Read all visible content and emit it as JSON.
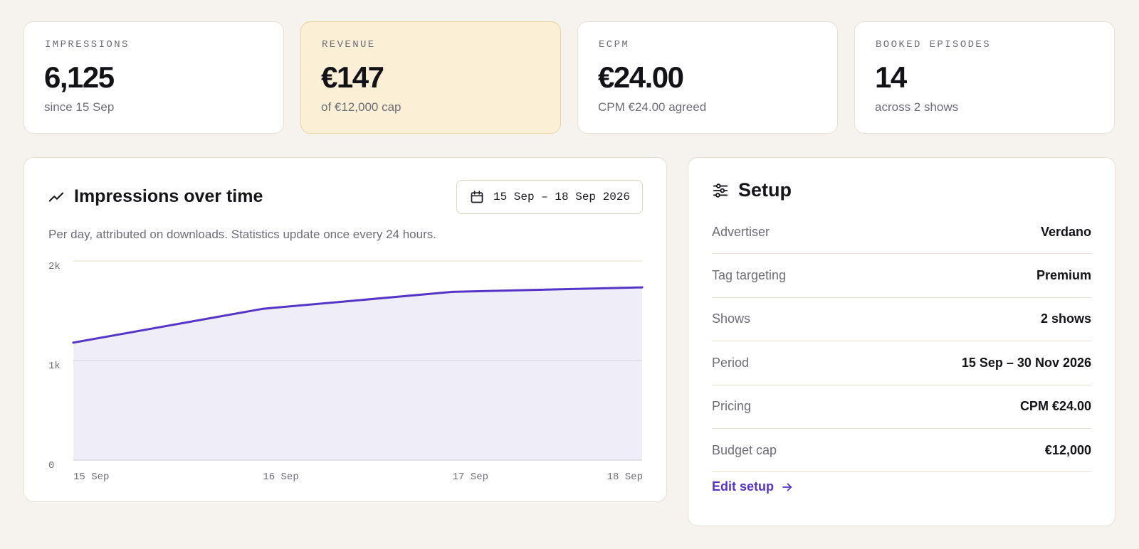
{
  "stats": [
    {
      "label": "IMPRESSIONS",
      "value": "6,125",
      "sub": "since 15 Sep"
    },
    {
      "label": "REVENUE",
      "value": "€147",
      "sub": "of €12,000 cap"
    },
    {
      "label": "ECPM",
      "value": "€24.00",
      "sub": "CPM €24.00 agreed"
    },
    {
      "label": "BOOKED EPISODES",
      "value": "14",
      "sub": "across 2 shows"
    }
  ],
  "chart_card": {
    "title": "Impressions over time",
    "date_range": "15 Sep – 18 Sep 2026",
    "description": "Per day, attributed on downloads. Statistics update once every 24 hours."
  },
  "chart_data": {
    "type": "area",
    "title": "",
    "xlabel": "",
    "ylabel": "",
    "categories": [
      "15 Sep",
      "16 Sep",
      "17 Sep",
      "18 Sep"
    ],
    "values": [
      1180,
      1520,
      1690,
      1735
    ],
    "ylim": [
      0,
      2000
    ],
    "yticks": [
      {
        "value": 0,
        "label": "0"
      },
      {
        "value": 1000,
        "label": "1k"
      },
      {
        "value": 2000,
        "label": "2k"
      }
    ],
    "grid": true,
    "line_color": "#5535c8",
    "fill_color": "#efedf8"
  },
  "setup": {
    "title": "Setup",
    "rows": [
      {
        "key": "Advertiser",
        "value": "Verdano"
      },
      {
        "key": "Tag targeting",
        "value": "Premium"
      },
      {
        "key": "Shows",
        "value": "2 shows"
      },
      {
        "key": "Period",
        "value": "15 Sep – 30 Nov 2026"
      },
      {
        "key": "Pricing",
        "value": "CPM €24.00"
      },
      {
        "key": "Budget cap",
        "value": "€12,000"
      }
    ],
    "edit_label": "Edit setup"
  },
  "colors": {
    "accent": "#5534c7",
    "highlight_bg": "#fbefd6",
    "page_bg": "#f6f3ee"
  },
  "icons": {
    "chart_title": "trending-up-icon",
    "date_button": "calendar-icon",
    "setup": "sliders-icon",
    "edit": "arrow-right-icon"
  }
}
